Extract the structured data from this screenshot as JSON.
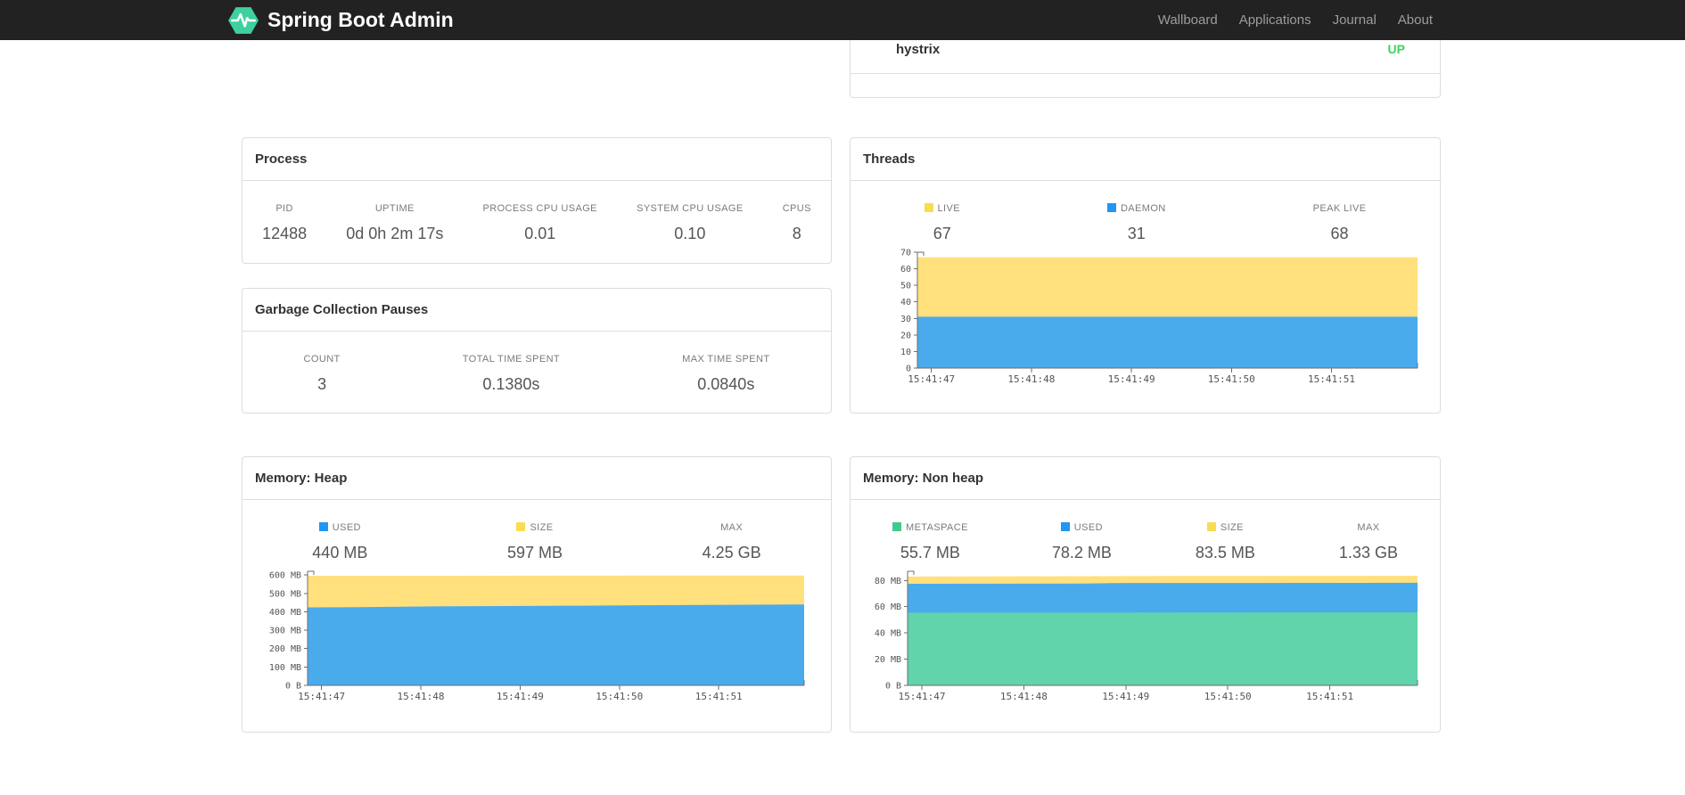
{
  "navbar": {
    "brand": "Spring Boot Admin",
    "links": [
      {
        "label": "Wallboard"
      },
      {
        "label": "Applications"
      },
      {
        "label": "Journal"
      },
      {
        "label": "About"
      }
    ]
  },
  "colors": {
    "navbar_bg": "#222222",
    "logo_green": "#3fd0a0",
    "status_up": "#3fd45f",
    "area_yellow": "#ffe07d",
    "area_blue": "#4aabec",
    "area_green": "#62d4ab",
    "swatch_yellow": "#fadc51",
    "swatch_blue": "#2196f3",
    "swatch_green": "#43c98f"
  },
  "application_row": {
    "name": "hystrix",
    "status": "UP"
  },
  "process_card": {
    "title": "Process",
    "stats": [
      {
        "label": "PID",
        "value": "12488"
      },
      {
        "label": "UPTIME",
        "value": "0d 0h 2m 17s"
      },
      {
        "label": "PROCESS CPU USAGE",
        "value": "0.01"
      },
      {
        "label": "SYSTEM CPU USAGE",
        "value": "0.10"
      },
      {
        "label": "CPUS",
        "value": "8"
      }
    ]
  },
  "gc_card": {
    "title": "Garbage Collection Pauses",
    "stats": [
      {
        "label": "COUNT",
        "value": "3"
      },
      {
        "label": "TOTAL TIME SPENT",
        "value": "0.1380s"
      },
      {
        "label": "MAX TIME SPENT",
        "value": "0.0840s"
      }
    ]
  },
  "threads_card": {
    "title": "Threads",
    "stats": [
      {
        "label": "LIVE",
        "value": "67",
        "swatch": "#fadc51"
      },
      {
        "label": "DAEMON",
        "value": "31",
        "swatch": "#2196f3"
      },
      {
        "label": "PEAK LIVE",
        "value": "68"
      }
    ]
  },
  "heap_card": {
    "title": "Memory: Heap",
    "stats": [
      {
        "label": "USED",
        "value": "440 MB",
        "swatch": "#2196f3"
      },
      {
        "label": "SIZE",
        "value": "597 MB",
        "swatch": "#fadc51"
      },
      {
        "label": "MAX",
        "value": "4.25 GB"
      }
    ]
  },
  "nonheap_card": {
    "title": "Memory: Non heap",
    "stats": [
      {
        "label": "METASPACE",
        "value": "55.7 MB",
        "swatch": "#43c98f"
      },
      {
        "label": "USED",
        "value": "78.2 MB",
        "swatch": "#2196f3"
      },
      {
        "label": "SIZE",
        "value": "83.5 MB",
        "swatch": "#fadc51"
      },
      {
        "label": "MAX",
        "value": "1.33 GB"
      }
    ]
  },
  "chart_data": [
    {
      "id": "threads",
      "type": "area",
      "title": "Threads",
      "xlabel": "",
      "ylabel": "",
      "grid": false,
      "legend_position": "top",
      "ylim": [
        0,
        70
      ],
      "yticks": [
        {
          "v": 0,
          "label": "0"
        },
        {
          "v": 10,
          "label": "10"
        },
        {
          "v": 20,
          "label": "20"
        },
        {
          "v": 30,
          "label": "30"
        },
        {
          "v": 40,
          "label": "40"
        },
        {
          "v": 50,
          "label": "50"
        },
        {
          "v": 60,
          "label": "60"
        },
        {
          "v": 70,
          "label": "70"
        }
      ],
      "xticks": [
        {
          "frac": 0.028,
          "label": "15:41:47"
        },
        {
          "frac": 0.228,
          "label": "15:41:48"
        },
        {
          "frac": 0.428,
          "label": "15:41:49"
        },
        {
          "frac": 0.628,
          "label": "15:41:50"
        },
        {
          "frac": 0.828,
          "label": "15:41:51"
        }
      ],
      "series": [
        {
          "name": "DAEMON",
          "color": "#4aabec",
          "points": [
            [
              0,
              31
            ],
            [
              1,
              31
            ]
          ]
        },
        {
          "name": "LIVE",
          "color": "#ffe07d",
          "points": [
            [
              0,
              67
            ],
            [
              1,
              67
            ]
          ]
        }
      ],
      "peak_live": 68
    },
    {
      "id": "memory-heap",
      "type": "area",
      "title": "Memory: Heap",
      "xlabel": "",
      "ylabel": "",
      "grid": false,
      "legend_position": "top",
      "ylim": [
        0,
        620
      ],
      "unit": "MB",
      "yticks": [
        {
          "v": 0,
          "label": "0 B"
        },
        {
          "v": 100,
          "label": "100 MB"
        },
        {
          "v": 200,
          "label": "200 MB"
        },
        {
          "v": 300,
          "label": "300 MB"
        },
        {
          "v": 400,
          "label": "400 MB"
        },
        {
          "v": 500,
          "label": "500 MB"
        },
        {
          "v": 600,
          "label": "600 MB"
        }
      ],
      "xticks": [
        {
          "frac": 0.028,
          "label": "15:41:47"
        },
        {
          "frac": 0.228,
          "label": "15:41:48"
        },
        {
          "frac": 0.428,
          "label": "15:41:49"
        },
        {
          "frac": 0.628,
          "label": "15:41:50"
        },
        {
          "frac": 0.828,
          "label": "15:41:51"
        }
      ],
      "series": [
        {
          "name": "USED",
          "color": "#4aabec",
          "points": [
            [
              0,
              424
            ],
            [
              0.1,
              425
            ],
            [
              0.25,
              429
            ],
            [
              0.4,
              431
            ],
            [
              0.55,
              433
            ],
            [
              0.7,
              436
            ],
            [
              0.85,
              438
            ],
            [
              1,
              440
            ]
          ]
        },
        {
          "name": "SIZE",
          "color": "#ffe07d",
          "points": [
            [
              0,
              596
            ],
            [
              0.5,
              596.5
            ],
            [
              1,
              597
            ]
          ]
        }
      ],
      "max": "4.25 GB"
    },
    {
      "id": "memory-nonheap",
      "type": "area",
      "title": "Memory: Non heap",
      "xlabel": "",
      "ylabel": "",
      "grid": false,
      "legend_position": "top",
      "ylim": [
        0,
        87
      ],
      "unit": "MB",
      "yticks": [
        {
          "v": 0,
          "label": "0 B"
        },
        {
          "v": 20,
          "label": "20 MB"
        },
        {
          "v": 40,
          "label": "40 MB"
        },
        {
          "v": 60,
          "label": "60 MB"
        },
        {
          "v": 80,
          "label": "80 MB"
        }
      ],
      "xticks": [
        {
          "frac": 0.028,
          "label": "15:41:47"
        },
        {
          "frac": 0.228,
          "label": "15:41:48"
        },
        {
          "frac": 0.428,
          "label": "15:41:49"
        },
        {
          "frac": 0.628,
          "label": "15:41:50"
        },
        {
          "frac": 0.828,
          "label": "15:41:51"
        }
      ],
      "series": [
        {
          "name": "METASPACE",
          "color": "#62d4ab",
          "points": [
            [
              0,
              55.4
            ],
            [
              1,
              55.7
            ]
          ]
        },
        {
          "name": "USED",
          "color": "#4aabec",
          "points": [
            [
              0,
              77.5
            ],
            [
              0.35,
              77.6
            ],
            [
              0.4,
              78.0
            ],
            [
              1,
              78.2
            ]
          ]
        },
        {
          "name": "SIZE",
          "color": "#ffe07d",
          "points": [
            [
              0,
              83.0
            ],
            [
              0.25,
              83.2
            ],
            [
              0.55,
              83.4
            ],
            [
              1,
              83.5
            ]
          ]
        }
      ],
      "max": "1.33 GB"
    }
  ]
}
